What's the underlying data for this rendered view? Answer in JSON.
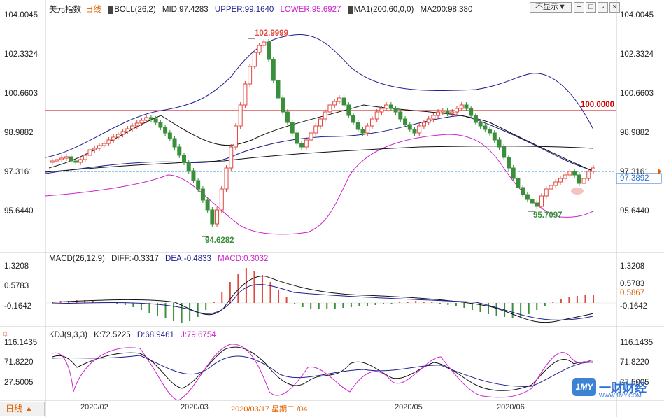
{
  "price_panel": {
    "symbol": "美元指数",
    "period": "日线",
    "boll_name": "BOLL(26,2)",
    "mid": "MID:97.4283",
    "upper": "UPPER:99.1640",
    "lower": "LOWER:95.6927",
    "ma_name": "MA1(200,60,0,0)",
    "ma200": "MA200:98.380",
    "ticks": [
      "104.0045",
      "102.3324",
      "100.6603",
      "98.9882",
      "97.3161",
      "95.6440"
    ],
    "last_price": "97.3892",
    "level_line": "100.0000",
    "high_label": "102.9999",
    "low_label": "94.6282",
    "low2_label": "95.7097"
  },
  "toolbar": {
    "hide_select": "不显示",
    "hide_arrow": "▼"
  },
  "macd_panel": {
    "name": "MACD(26,12,9)",
    "diff": "DIFF:-0.3317",
    "dea": "DEA:-0.4833",
    "macd": "MACD:0.3032",
    "ticks_left": [
      "1.3208",
      "0.5783",
      "-0.1642"
    ],
    "ticks_right": [
      "1.3208",
      "0.5783",
      "-0.1642"
    ],
    "current": "0.5867"
  },
  "kdj_panel": {
    "name": "KDJ(9,3,3)",
    "k": "K:72.5225",
    "d": "D:68.9461",
    "j": "J:79.6754",
    "ticks": [
      "116.1435",
      "71.8220",
      "27.5005"
    ],
    "right_last": "27.5005"
  },
  "time_axis": {
    "period_button": "日线 ▲",
    "labels": [
      "2020/02",
      "2020/03",
      "2020/03/17 星期二 /04",
      "2020/05",
      "2020/06"
    ]
  },
  "watermark": {
    "logo_text": "1MY",
    "name": "一财财经",
    "url": "WWW.1MY.COM"
  },
  "colors": {
    "up": "#e0473d",
    "down": "#3a8f3a",
    "upper": "#1f1f8f",
    "lower": "#cc22cc",
    "level": "#cc0000",
    "price": "#2b6fd6"
  }
}
